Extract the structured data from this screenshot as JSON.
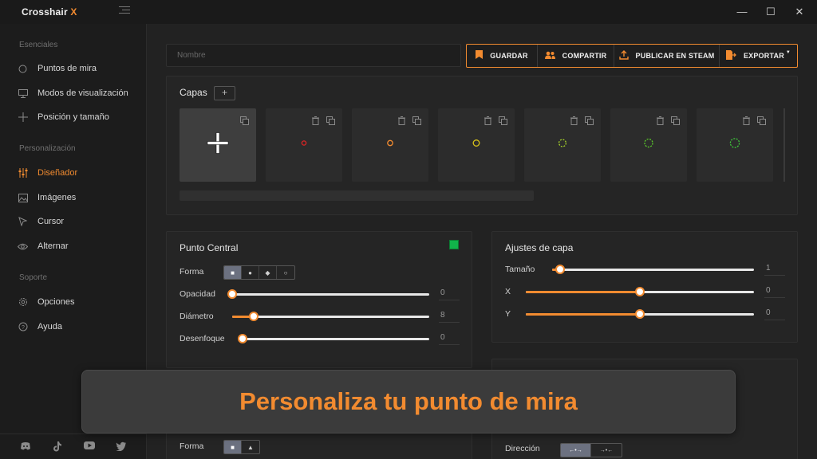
{
  "app": {
    "name": "Crosshair",
    "name_accent": "X",
    "window_controls": {
      "minimize": "—",
      "maximize": "☐",
      "close": "✕"
    }
  },
  "sidebar": {
    "sections": [
      {
        "label": "Esenciales"
      },
      {
        "label": "Personalización"
      },
      {
        "label": "Soporte"
      }
    ],
    "items": [
      {
        "label": "Puntos de mira",
        "icon": "circle-icon"
      },
      {
        "label": "Modos de visualización",
        "icon": "monitor-icon"
      },
      {
        "label": "Posición y tamaño",
        "icon": "move-icon"
      },
      {
        "label": "Diseñador",
        "icon": "sliders-icon",
        "active": true
      },
      {
        "label": "Imágenes",
        "icon": "image-icon"
      },
      {
        "label": "Cursor",
        "icon": "cursor-icon"
      },
      {
        "label": "Alternar",
        "icon": "eye-icon"
      },
      {
        "label": "Opciones",
        "icon": "gear-icon"
      },
      {
        "label": "Ayuda",
        "icon": "help-icon"
      }
    ],
    "social": [
      "discord-icon",
      "tiktok-icon",
      "youtube-icon",
      "twitter-icon"
    ]
  },
  "toolbar": {
    "name_placeholder": "Nombre",
    "save_label": "GUARDAR",
    "share_label": "COMPARTIR",
    "publish_label": "PUBLICAR EN STEAM",
    "export_label": "EXPORTAR"
  },
  "layers": {
    "title": "Capas",
    "add_label": "+",
    "items": [
      {
        "color": "#ffffff",
        "selected": true
      },
      {
        "color": "#e02424"
      },
      {
        "color": "#f28b30"
      },
      {
        "color": "#d8c21a"
      },
      {
        "color": "#a9d62a"
      },
      {
        "color": "#5cd12a"
      },
      {
        "color": "#3ec93a"
      }
    ]
  },
  "center_dot": {
    "title": "Punto Central",
    "color": "#11b34a",
    "shape_label": "Forma",
    "shape_options": [
      "■",
      "●",
      "◆",
      "○"
    ],
    "rows": [
      {
        "label": "Opacidad",
        "value": "0",
        "fraction": 0.0
      },
      {
        "label": "Diámetro",
        "value": "8",
        "fraction": 0.11
      },
      {
        "label": "Desenfoque",
        "value": "0",
        "fraction": 0.0
      }
    ]
  },
  "layer_settings": {
    "title": "Ajustes de capa",
    "rows": [
      {
        "label": "Tamaño",
        "value": "1",
        "fraction": 0.04
      },
      {
        "label": "X",
        "value": "0",
        "fraction": 0.5
      },
      {
        "label": "Y",
        "value": "0",
        "fraction": 0.5
      }
    ]
  },
  "bottom_left": {
    "shape_label": "Forma",
    "shape_options": [
      "■",
      "▲"
    ]
  },
  "bottom_right": {
    "direction_label": "Dirección",
    "direction_options": [
      "←•→",
      "→•←"
    ]
  },
  "banner": {
    "text": "Personaliza tu punto de mira"
  }
}
